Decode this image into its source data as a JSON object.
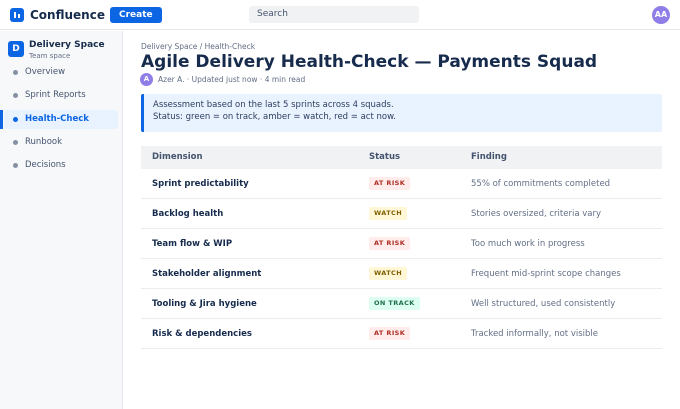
{
  "topbar": {
    "brand": "Confluence",
    "create_label": "Create",
    "search_placeholder": "Search",
    "user_initials": "AA"
  },
  "sidebar": {
    "space_initial": "D",
    "space_name": "Delivery Space",
    "space_type": "Team space",
    "items": [
      {
        "label": "Overview",
        "active": false
      },
      {
        "label": "Sprint Reports",
        "active": false
      },
      {
        "label": "Health-Check",
        "active": true
      },
      {
        "label": "Runbook",
        "active": false
      },
      {
        "label": "Decisions",
        "active": false
      }
    ]
  },
  "page": {
    "breadcrumb": "Delivery Space / Health-Check",
    "title": "Agile Delivery Health-Check — Payments Squad",
    "author_initial": "A",
    "meta": "Azer A. · Updated just now · 4 min read",
    "panel_line1": "Assessment based on the last 5 sprints across 4 squads.",
    "panel_line2": "Status: green = on track, amber = watch, red = act now."
  },
  "table": {
    "headers": {
      "dimension": "Dimension",
      "status": "Status",
      "finding": "Finding"
    },
    "rows": [
      {
        "dimension": "Sprint predictability",
        "status": "AT RISK",
        "finding": "55% of commitments completed"
      },
      {
        "dimension": "Backlog health",
        "status": "WATCH",
        "finding": "Stories oversized, criteria vary"
      },
      {
        "dimension": "Team flow & WIP",
        "status": "AT RISK",
        "finding": "Too much work in progress"
      },
      {
        "dimension": "Stakeholder alignment",
        "status": "WATCH",
        "finding": "Frequent mid-sprint scope changes"
      },
      {
        "dimension": "Tooling & Jira hygiene",
        "status": "ON TRACK",
        "finding": "Well structured, used consistently"
      },
      {
        "dimension": "Risk & dependencies",
        "status": "AT RISK",
        "finding": "Tracked informally, not visible"
      }
    ]
  },
  "status_colors": {
    "at_risk": "#ae2e24",
    "watch": "#7f5f01",
    "on_track": "#216e4e",
    "accent": "#0c66e4"
  }
}
